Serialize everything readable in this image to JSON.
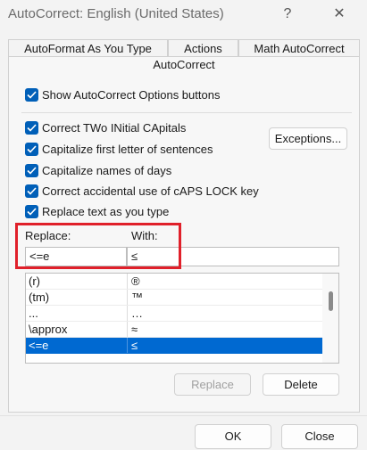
{
  "window": {
    "title": "AutoCorrect: English (United States)",
    "help_glyph": "?",
    "close_glyph": "✕"
  },
  "tabs": {
    "row1": [
      "AutoFormat As You Type",
      "Actions",
      "Math AutoCorrect"
    ],
    "active": "AutoCorrect"
  },
  "options": {
    "show_buttons": {
      "label": "Show AutoCorrect Options buttons",
      "checked": true
    },
    "correct_two_initials": {
      "label": "Correct TWo INitial CApitals",
      "checked": true
    },
    "capitalize_first": {
      "label": "Capitalize first letter of sentences",
      "checked": true
    },
    "capitalize_days": {
      "label": "Capitalize names of days",
      "checked": true
    },
    "caps_lock": {
      "label": "Correct accidental use of cAPS LOCK key",
      "checked": true
    },
    "replace_text": {
      "label": "Replace text as you type",
      "checked": true
    }
  },
  "buttons": {
    "exceptions": "Exceptions...",
    "replace": "Replace",
    "delete": "Delete",
    "ok": "OK",
    "close": "Close"
  },
  "replace_section": {
    "replace_label": "Replace:",
    "with_label": "With:",
    "replace_value": "<=e",
    "with_value": "≤"
  },
  "entries": [
    {
      "replace": "(r)",
      "with": "®"
    },
    {
      "replace": "(tm)",
      "with": "™"
    },
    {
      "replace": "...",
      "with": "…"
    },
    {
      "replace": "\\approx",
      "with": "≈"
    },
    {
      "replace": "<=e",
      "with": "≤"
    }
  ],
  "selected_entry_index": 4,
  "colors": {
    "accent": "#005fb8",
    "selection": "#0069d1",
    "highlight_box": "#e0202a"
  }
}
